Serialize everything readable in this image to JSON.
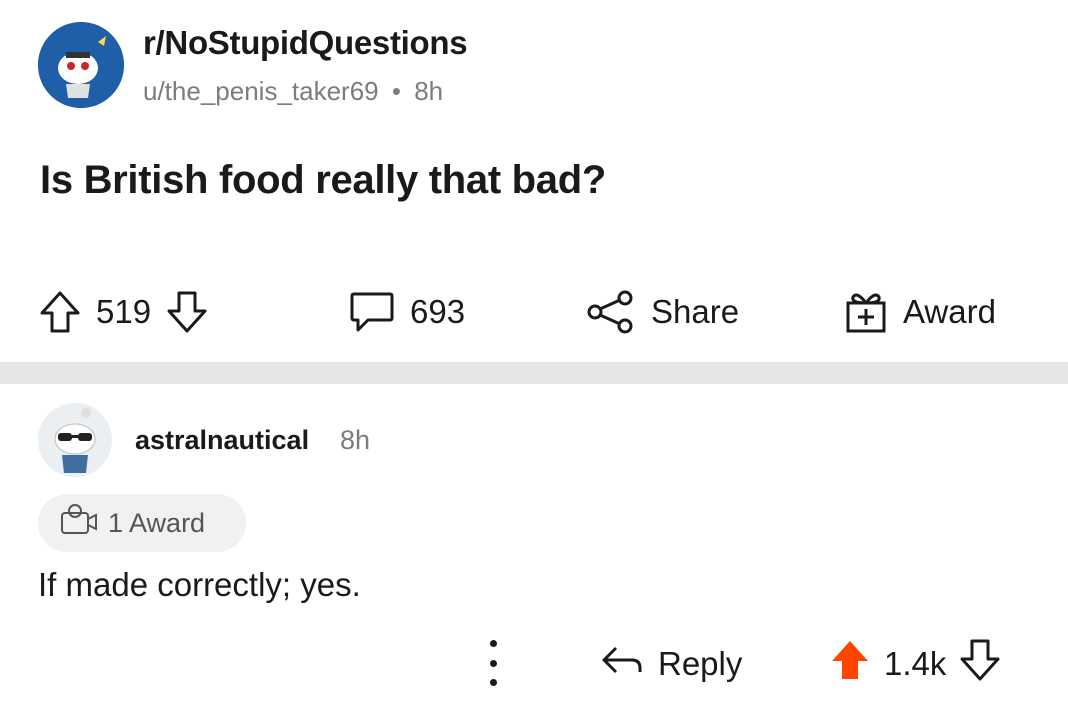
{
  "post": {
    "subreddit": "r/NoStupidQuestions",
    "author": "u/the_penis_taker69",
    "separator": "•",
    "age": "8h",
    "title": "Is British food really that bad?",
    "upvotes": "519",
    "comments": "693",
    "share_label": "Share",
    "award_label": "Award"
  },
  "comment": {
    "author": "astralnautical",
    "age": "8h",
    "award_chip": "1 Award",
    "body": "If made correctly; yes.",
    "reply_label": "Reply",
    "score": "1.4k"
  },
  "colors": {
    "upvote_active": "#ff4500",
    "subreddit_avatar_bg": "#1f5fa8",
    "divider": "#e6e6e6",
    "meta_text": "#7c7c7c"
  },
  "icons": {
    "post_upvote": "up-arrow-outline-icon",
    "post_downvote": "down-arrow-outline-icon",
    "comment": "comment-bubble-icon",
    "share": "share-nodes-icon",
    "award": "gift-box-icon",
    "comment_award": "award-medal-icon",
    "more": "vertical-dots-icon",
    "reply": "reply-arrow-icon",
    "comment_upvote": "up-arrow-filled-icon",
    "comment_downvote": "down-arrow-outline-icon"
  }
}
